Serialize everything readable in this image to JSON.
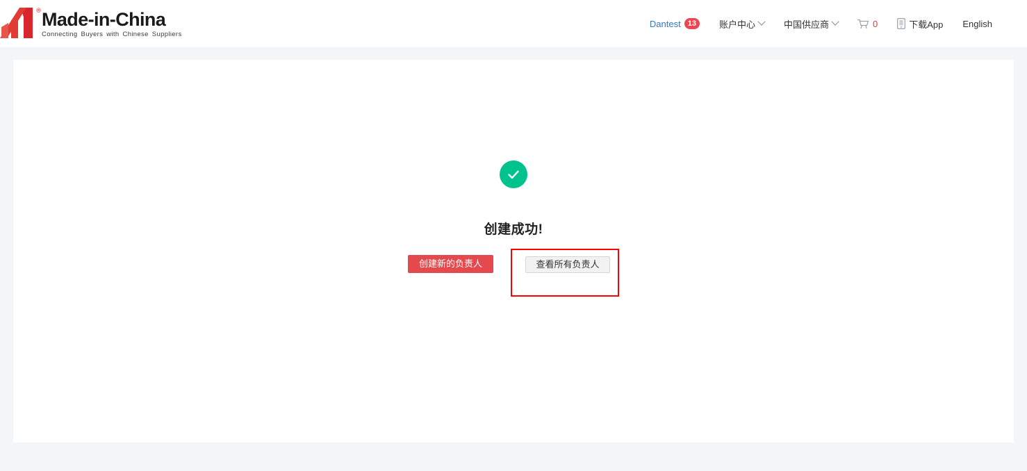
{
  "header": {
    "logo": {
      "title": "Made-in-China",
      "tagline": "Connecting Buyers with Chinese Suppliers",
      "registered_mark": "®",
      "brand_color": "#d9262c"
    },
    "nav": {
      "user_name": "Dantest",
      "user_badge": "13",
      "account_center": "账户中心",
      "china_suppliers": "中国供应商",
      "cart_count": "0",
      "download_app": "下载App",
      "language": "English",
      "link_color": "#3478c0",
      "badge_color": "#ef4452",
      "cart_count_color": "#e4393c"
    }
  },
  "main": {
    "status_icon": "check-circle-icon",
    "status_icon_color": "#00c28c",
    "title": "创建成功!",
    "primary_button": "创建新的负责人",
    "primary_button_color": "#e4494e",
    "secondary_button": "查看所有负责人",
    "annotation_color": "#ff0000"
  }
}
